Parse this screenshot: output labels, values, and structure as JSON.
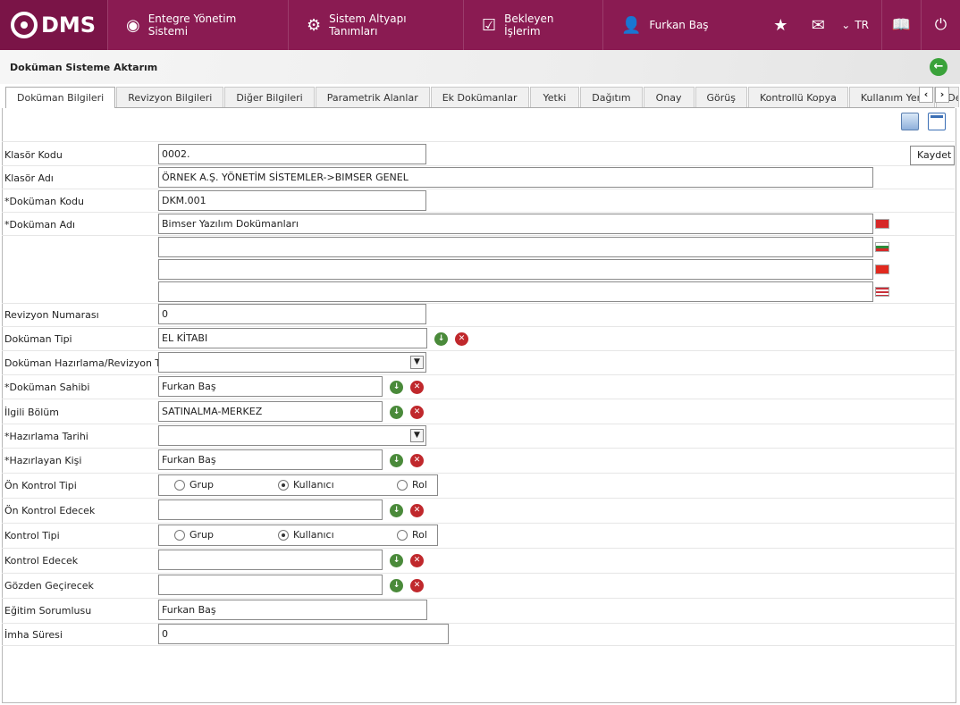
{
  "app": {
    "logo_text": "DMS"
  },
  "nav": {
    "items": [
      {
        "label": "Entegre Yönetim Sistemi",
        "icon": "q-logo-icon"
      },
      {
        "label": "Sistem Altyapı Tanımları",
        "icon": "gear-icon"
      },
      {
        "label": "Bekleyen İşlerim",
        "icon": "clipboard-icon"
      },
      {
        "label": "Furkan Baş",
        "icon": "user-icon"
      }
    ],
    "language": "TR"
  },
  "page": {
    "title": "Doküman Sisteme Aktarım"
  },
  "tabs": [
    "Doküman Bilgileri",
    "Revizyon Bilgileri",
    "Diğer Bilgileri",
    "Parametrik Alanlar",
    "Ek Dokümanlar",
    "Yetki",
    "Dağıtım",
    "Onay",
    "Görüş",
    "Kontrollü Kopya",
    "Kullanım Yeri",
    "Denetim Sor"
  ],
  "toolbar": {
    "tooltip": "Kaydet"
  },
  "form": {
    "klasor_kodu": {
      "label": "Klasör Kodu",
      "value": "0002."
    },
    "klasor_adi": {
      "label": "Klasör Adı",
      "value": "ÖRNEK A.Ş. YÖNETİM SİSTEMLER->BIMSER GENEL"
    },
    "dokuman_kodu": {
      "label": "*Doküman Kodu",
      "value": "DKM.001"
    },
    "dokuman_adi": {
      "label": "*Doküman Adı",
      "value": "Bimser Yazılım Dokümanları",
      "value2": "",
      "value3": "",
      "value4": ""
    },
    "revizyon_numarasi": {
      "label": "Revizyon Numarası",
      "value": "0"
    },
    "dokuman_tipi": {
      "label": "Doküman Tipi",
      "value": "EL KİTABI"
    },
    "hazirlama_turu": {
      "label": "Doküman Hazırlama/Revizyon Türü",
      "value": ""
    },
    "dokuman_sahibi": {
      "label": "*Doküman Sahibi",
      "value": "Furkan Baş"
    },
    "ilgili_bolum": {
      "label": "İlgili Bölüm",
      "value": "SATINALMA-MERKEZ"
    },
    "hazirlama_tarihi": {
      "label": "*Hazırlama Tarihi",
      "value": ""
    },
    "hazirlayan_kisi": {
      "label": "*Hazırlayan Kişi",
      "value": "Furkan Baş"
    },
    "on_kontrol_tipi": {
      "label": "Ön Kontrol Tipi",
      "options": [
        "Grup",
        "Kullanıcı",
        "Rol"
      ],
      "selected": "Kullanıcı"
    },
    "on_kontrol_edecek": {
      "label": "Ön Kontrol Edecek",
      "value": ""
    },
    "kontrol_tipi": {
      "label": "Kontrol Tipi",
      "options": [
        "Grup",
        "Kullanıcı",
        "Rol"
      ],
      "selected": "Kullanıcı"
    },
    "kontrol_edecek": {
      "label": "Kontrol Edecek",
      "value": ""
    },
    "gozden_gecirecek": {
      "label": "Gözden Geçirecek",
      "value": ""
    },
    "egitim_sorumlusu": {
      "label": "Eğitim Sorumlusu",
      "value": "Furkan Baş"
    },
    "imha_suresi": {
      "label": "İmha Süresi",
      "value": "0"
    }
  },
  "flags": [
    "flag-tr-icon",
    "flag-bg-icon",
    "flag-cn-icon",
    "flag-us-icon"
  ]
}
